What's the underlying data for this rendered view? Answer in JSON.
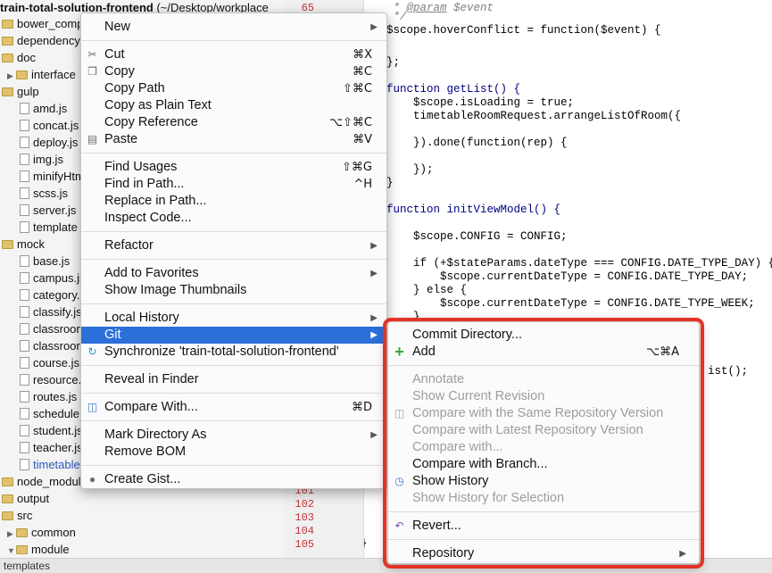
{
  "project": {
    "name": "train-total-solution-frontend",
    "path": " (~/Desktop/workplace",
    "items": [
      {
        "label": "bower_comp",
        "kind": "folder",
        "depth": 0,
        "arrow": ""
      },
      {
        "label": "dependency",
        "kind": "folder",
        "depth": 0,
        "arrow": ""
      },
      {
        "label": "doc",
        "kind": "folder",
        "depth": 0,
        "arrow": ""
      },
      {
        "label": "interface",
        "kind": "folder",
        "depth": 1,
        "arrow": "▶"
      },
      {
        "label": "gulp",
        "kind": "folder",
        "depth": 0,
        "arrow": ""
      },
      {
        "label": "amd.js",
        "kind": "js",
        "depth": 2,
        "arrow": ""
      },
      {
        "label": "concat.js",
        "kind": "js",
        "depth": 2,
        "arrow": ""
      },
      {
        "label": "deploy.js",
        "kind": "js",
        "depth": 2,
        "arrow": ""
      },
      {
        "label": "img.js",
        "kind": "js",
        "depth": 2,
        "arrow": ""
      },
      {
        "label": "minifyHtm",
        "kind": "js",
        "depth": 2,
        "arrow": ""
      },
      {
        "label": "scss.js",
        "kind": "js",
        "depth": 2,
        "arrow": ""
      },
      {
        "label": "server.js",
        "kind": "js",
        "depth": 2,
        "arrow": ""
      },
      {
        "label": "template",
        "kind": "js",
        "depth": 2,
        "arrow": ""
      },
      {
        "label": "mock",
        "kind": "folder",
        "depth": 0,
        "arrow": ""
      },
      {
        "label": "base.js",
        "kind": "js",
        "depth": 2,
        "arrow": ""
      },
      {
        "label": "campus.js",
        "kind": "js",
        "depth": 2,
        "arrow": ""
      },
      {
        "label": "category.",
        "kind": "js",
        "depth": 2,
        "arrow": ""
      },
      {
        "label": "classify.js",
        "kind": "js",
        "depth": 2,
        "arrow": ""
      },
      {
        "label": "classroon",
        "kind": "js",
        "depth": 2,
        "arrow": ""
      },
      {
        "label": "classroon",
        "kind": "js",
        "depth": 2,
        "arrow": ""
      },
      {
        "label": "course.js",
        "kind": "js",
        "depth": 2,
        "arrow": ""
      },
      {
        "label": "resource.",
        "kind": "js",
        "depth": 2,
        "arrow": ""
      },
      {
        "label": "routes.js",
        "kind": "js",
        "depth": 2,
        "arrow": ""
      },
      {
        "label": "schedule.",
        "kind": "js",
        "depth": 2,
        "arrow": ""
      },
      {
        "label": "student.js",
        "kind": "js",
        "depth": 2,
        "arrow": ""
      },
      {
        "label": "teacher.js",
        "kind": "js",
        "depth": 2,
        "arrow": ""
      },
      {
        "label": "timetable",
        "kind": "js",
        "depth": 2,
        "arrow": ""
      },
      {
        "label": "node_module",
        "kind": "folder",
        "depth": 0,
        "arrow": ""
      },
      {
        "label": "output",
        "kind": "folder",
        "depth": 0,
        "arrow": ""
      },
      {
        "label": "src",
        "kind": "folder",
        "depth": 0,
        "arrow": ""
      },
      {
        "label": "common",
        "kind": "folder",
        "depth": 1,
        "arrow": "▶"
      },
      {
        "label": "module",
        "kind": "folder",
        "depth": 1,
        "arrow": "▼"
      }
    ]
  },
  "gutter": {
    "top_line": "65",
    "bottom_lines": [
      "101",
      "102",
      "103",
      "104",
      "105"
    ]
  },
  "status_bar": "templates",
  "context_menu": {
    "items": [
      {
        "label": "New",
        "shortcut": "",
        "submenu": true,
        "icon": ""
      },
      {
        "label": "Cut",
        "shortcut": "⌘X",
        "submenu": false,
        "icon": "scissors-icon"
      },
      {
        "label": "Copy",
        "shortcut": "⌘C",
        "submenu": false,
        "icon": "copy-icon"
      },
      {
        "label": "Copy Path",
        "shortcut": "⇧⌘C",
        "submenu": false,
        "icon": ""
      },
      {
        "label": "Copy as Plain Text",
        "shortcut": "",
        "submenu": false,
        "icon": ""
      },
      {
        "label": "Copy Reference",
        "shortcut": "⌥⇧⌘C",
        "submenu": false,
        "icon": ""
      },
      {
        "label": "Paste",
        "shortcut": "⌘V",
        "submenu": false,
        "icon": "paste-icon"
      },
      {
        "label": "Find Usages",
        "shortcut": "⇧⌘G",
        "submenu": false,
        "icon": ""
      },
      {
        "label": "Find in Path...",
        "shortcut": "^H",
        "submenu": false,
        "icon": ""
      },
      {
        "label": "Replace in Path...",
        "shortcut": "",
        "submenu": false,
        "icon": ""
      },
      {
        "label": "Inspect Code...",
        "shortcut": "",
        "submenu": false,
        "icon": ""
      },
      {
        "label": "Refactor",
        "shortcut": "",
        "submenu": true,
        "icon": ""
      },
      {
        "label": "Add to Favorites",
        "shortcut": "",
        "submenu": true,
        "icon": ""
      },
      {
        "label": "Show Image Thumbnails",
        "shortcut": "",
        "submenu": false,
        "icon": ""
      },
      {
        "label": "Local History",
        "shortcut": "",
        "submenu": true,
        "icon": ""
      },
      {
        "label": "Git",
        "shortcut": "",
        "submenu": true,
        "icon": ""
      },
      {
        "label": "Synchronize 'train-total-solution-frontend'",
        "shortcut": "",
        "submenu": false,
        "icon": "sync-icon"
      },
      {
        "label": "Reveal in Finder",
        "shortcut": "",
        "submenu": false,
        "icon": ""
      },
      {
        "label": "Compare With...",
        "shortcut": "⌘D",
        "submenu": false,
        "icon": "compare-icon"
      },
      {
        "label": "Mark Directory As",
        "shortcut": "",
        "submenu": true,
        "icon": ""
      },
      {
        "label": "Remove BOM",
        "shortcut": "",
        "submenu": false,
        "icon": ""
      },
      {
        "label": "Create Gist...",
        "shortcut": "",
        "submenu": false,
        "icon": "github-icon"
      }
    ],
    "highlighted": "Git"
  },
  "git_menu": {
    "items": [
      {
        "label": "Commit Directory...",
        "shortcut": "",
        "enabled": true,
        "submenu": false,
        "icon": ""
      },
      {
        "label": "Add",
        "shortcut": "⌥⌘A",
        "enabled": true,
        "submenu": false,
        "icon": "plus-icon"
      },
      {
        "label": "Annotate",
        "shortcut": "",
        "enabled": false,
        "submenu": false,
        "icon": ""
      },
      {
        "label": "Show Current Revision",
        "shortcut": "",
        "enabled": false,
        "submenu": false,
        "icon": ""
      },
      {
        "label": "Compare with the Same Repository Version",
        "shortcut": "",
        "enabled": false,
        "submenu": false,
        "icon": "compare-icon"
      },
      {
        "label": "Compare with Latest Repository Version",
        "shortcut": "",
        "enabled": false,
        "submenu": false,
        "icon": ""
      },
      {
        "label": "Compare with...",
        "shortcut": "",
        "enabled": false,
        "submenu": false,
        "icon": ""
      },
      {
        "label": "Compare with Branch...",
        "shortcut": "",
        "enabled": true,
        "submenu": false,
        "icon": ""
      },
      {
        "label": "Show History",
        "shortcut": "",
        "enabled": true,
        "submenu": false,
        "icon": "history-icon"
      },
      {
        "label": "Show History for Selection",
        "shortcut": "",
        "enabled": false,
        "submenu": false,
        "icon": ""
      },
      {
        "label": "Revert...",
        "shortcut": "",
        "enabled": true,
        "submenu": false,
        "icon": "revert-icon"
      },
      {
        "label": "Repository",
        "shortcut": "",
        "enabled": true,
        "submenu": true,
        "icon": ""
      }
    ],
    "highlight_color": "#e53224"
  },
  "editor": {
    "lines": [
      {
        "l1": " * ",
        "l2": "@param",
        "l3": " $event"
      },
      {
        "t": " */"
      },
      {
        "t": "$scope.hoverConflict = function($event) {"
      },
      {
        "t": ""
      },
      {
        "t": "};"
      },
      {
        "t": ""
      },
      {
        "t": "function getList() {"
      },
      {
        "t": "    $scope.isLoading = true;"
      },
      {
        "t": "    timetableRoomRequest.arrangeListOfRoom({"
      },
      {
        "t": ""
      },
      {
        "t": "    }).done(function(rep) {"
      },
      {
        "t": ""
      },
      {
        "t": "    });"
      },
      {
        "t": "}"
      },
      {
        "t": ""
      },
      {
        "t": "function initViewModel() {"
      },
      {
        "t": ""
      },
      {
        "t": "    $scope.CONFIG = CONFIG;"
      },
      {
        "t": ""
      },
      {
        "t": "    if (+$stateParams.dateType === CONFIG.DATE_TYPE_DAY) {"
      },
      {
        "t": "        $scope.currentDateType = CONFIG.DATE_TYPE_DAY;"
      },
      {
        "t": "    } else {"
      },
      {
        "t": "        $scope.currentDateType = CONFIG.DATE_TYPE_WEEK;"
      },
      {
        "t": "    }"
      }
    ],
    "partial_line": "ist();",
    "closing_brace": "}"
  }
}
